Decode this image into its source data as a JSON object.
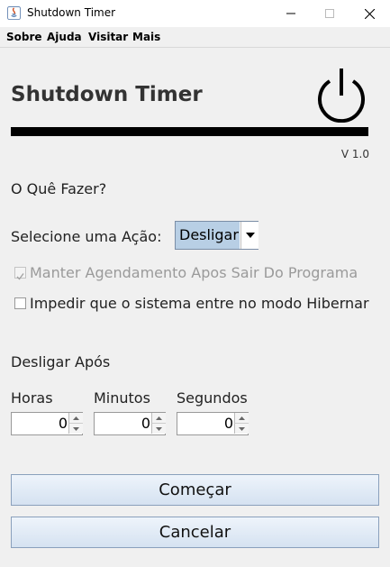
{
  "window": {
    "title": "Shutdown Timer",
    "controls": {
      "minimize": "—",
      "maximize": "☐",
      "close": "✕"
    }
  },
  "menu": [
    "Sobre",
    "Ajuda",
    "Visitar",
    "Mais"
  ],
  "header": {
    "title": "Shutdown Timer",
    "version": "V 1.0"
  },
  "action_section": {
    "heading": "O Quê Fazer?",
    "select_label": "Selecione uma Ação:",
    "selected_action": "Desligar"
  },
  "options": {
    "keep_schedule": {
      "label": "Manter Agendamento Apos Sair Do Programa",
      "checked": true,
      "enabled": false
    },
    "prevent_hibernate": {
      "label": "Impedir que o sistema entre no modo Hibernar",
      "checked": false,
      "enabled": true
    }
  },
  "timer": {
    "heading": "Desligar Após",
    "hours": {
      "label": "Horas",
      "value": "0"
    },
    "minutes": {
      "label": "Minutos",
      "value": "0"
    },
    "seconds": {
      "label": "Segundos",
      "value": "0"
    }
  },
  "buttons": {
    "start": "Começar",
    "cancel": "Cancelar"
  },
  "colors": {
    "selection": "#b8cfe5",
    "bar": "#000000",
    "button_border": "#8aa0bc"
  }
}
